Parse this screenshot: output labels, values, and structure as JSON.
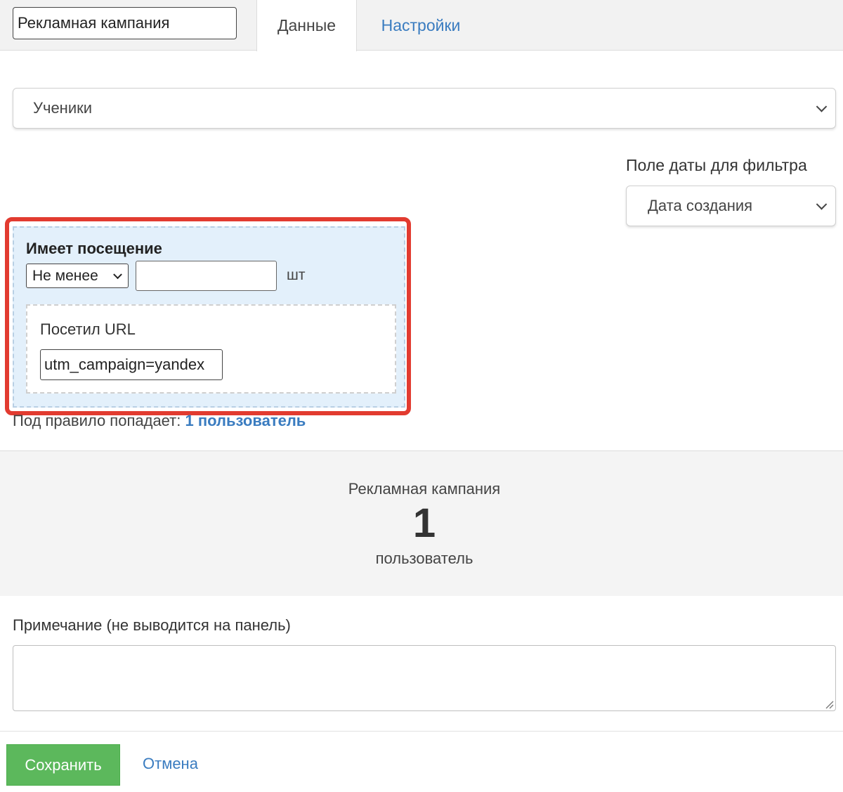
{
  "header": {
    "title_value": "Рекламная кампания",
    "tabs": [
      {
        "label": "Данные",
        "active": true
      },
      {
        "label": "Настройки",
        "active": false
      }
    ]
  },
  "source_select": {
    "value": "Ученики"
  },
  "date_filter": {
    "label": "Поле даты для фильтра",
    "value": "Дата создания"
  },
  "rule": {
    "title": "Имеет посещение",
    "operator": "Не менее",
    "count_value": "",
    "unit": "шт",
    "url_label": "Посетил URL",
    "url_value": "utm_campaign=yandex"
  },
  "match": {
    "prefix": "Под правило попадает:",
    "link": "1 пользователь"
  },
  "summary": {
    "title": "Рекламная кампания",
    "count": "1",
    "unit": "пользователь"
  },
  "note": {
    "label": "Примечание (не выводится на панель)",
    "value": ""
  },
  "actions": {
    "save": "Сохранить",
    "cancel": "Отмена"
  },
  "colors": {
    "accent": "#3a7cc0",
    "save": "#5cb85c",
    "highlight": "#e23b30",
    "rule_bg": "#e3f0fb"
  }
}
